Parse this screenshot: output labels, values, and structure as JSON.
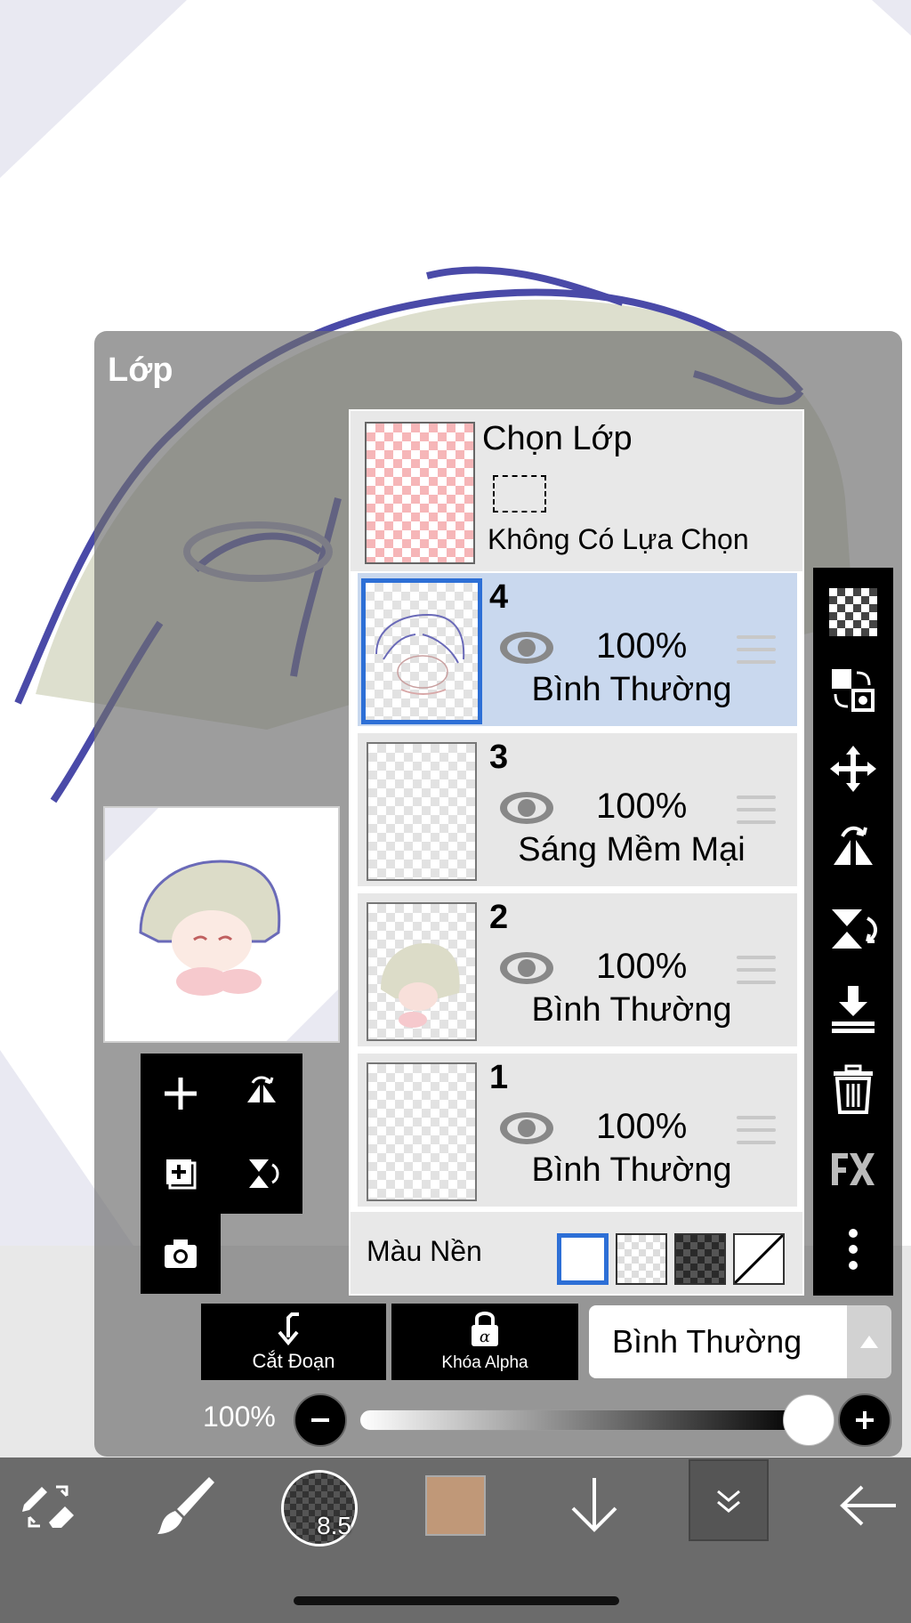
{
  "panel": {
    "title": "Lớp"
  },
  "selection_layer": {
    "title": "Chọn Lớp",
    "status": "Không Có Lựa Chọn"
  },
  "layers": [
    {
      "number": "4",
      "opacity": "100%",
      "blend": "Bình Thường",
      "selected": true
    },
    {
      "number": "3",
      "opacity": "100%",
      "blend": "Sáng Mềm Mại",
      "selected": false
    },
    {
      "number": "2",
      "opacity": "100%",
      "blend": "Bình Thường",
      "selected": false
    },
    {
      "number": "1",
      "opacity": "100%",
      "blend": "Bình Thường",
      "selected": false
    }
  ],
  "background": {
    "label": "Màu Nền",
    "selected_index": 0
  },
  "buttons": {
    "clip": "Cắt Đoạn",
    "alpha_lock": "Khóa Alpha",
    "blend_mode": "Bình Thường"
  },
  "opacity_slider": {
    "label": "100%",
    "value": 1.0
  },
  "toolbar": {
    "brush_size": "8.5",
    "color": "#c09878"
  },
  "colors": {
    "accent": "#2d6fd6",
    "selected_row": "#c9d8ee",
    "hair_line": "#4a4aa8"
  }
}
